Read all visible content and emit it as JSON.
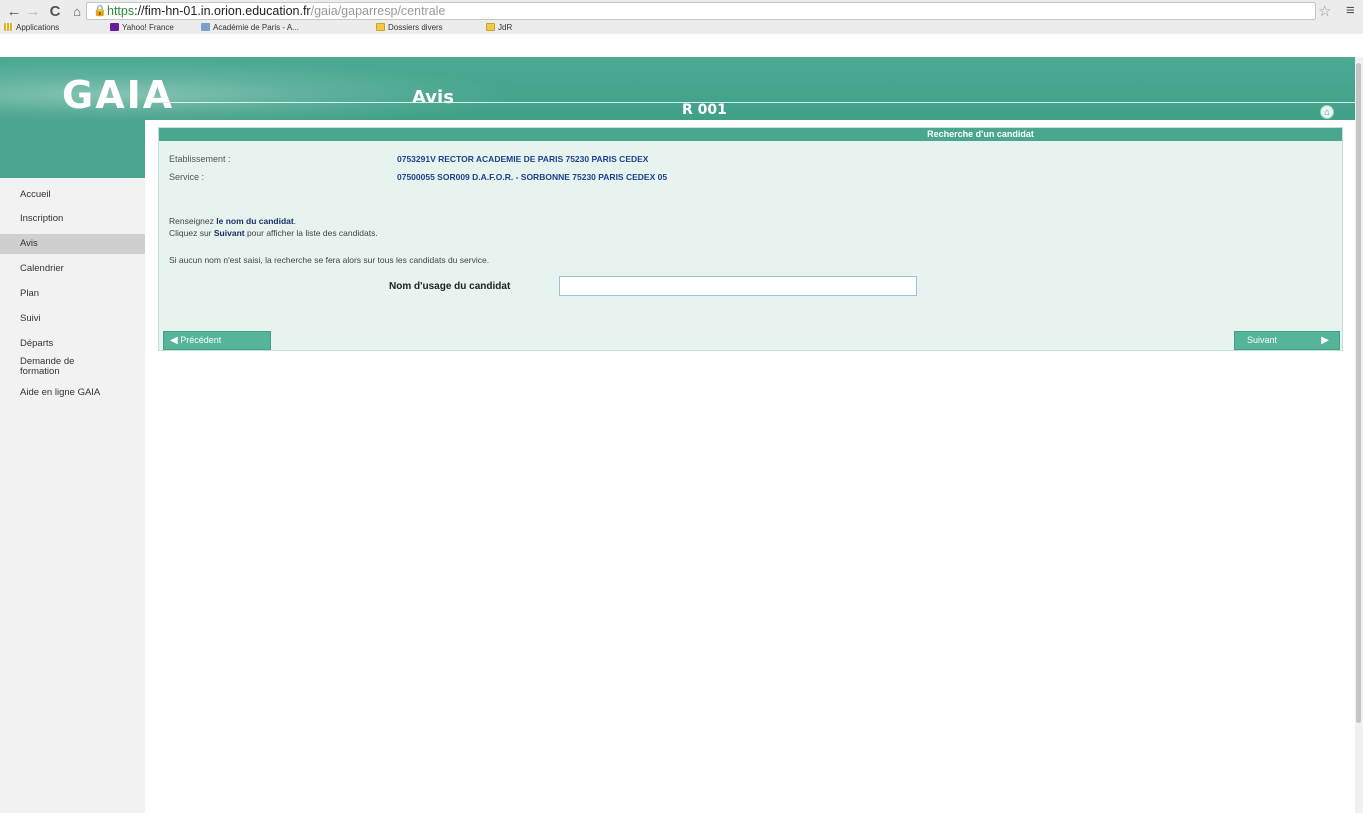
{
  "browser": {
    "url_scheme": "https",
    "url_host": "://fim-hn-01.in.orion.education.fr",
    "url_path": "/gaia/gaparresp/centrale",
    "bookmarks": [
      {
        "label": "Applications",
        "type": "apps"
      },
      {
        "label": "Yahoo! France",
        "type": "yahoo"
      },
      {
        "label": "Académie de Paris - A...",
        "type": "ac"
      },
      {
        "label": "Dossiers divers",
        "type": "folder"
      },
      {
        "label": "JdR",
        "type": "folder"
      }
    ]
  },
  "header": {
    "logo": "GAIA",
    "module": "Avis",
    "screen_code": "R 001"
  },
  "sidebar": {
    "items": [
      {
        "label": "Accueil"
      },
      {
        "label": "Inscription"
      },
      {
        "label": "Avis",
        "active": true
      },
      {
        "label": "Calendrier"
      },
      {
        "label": "Plan"
      },
      {
        "label": "Suivi"
      },
      {
        "label": "Départs"
      },
      {
        "label": "Demande de formation"
      },
      {
        "label": "Aide en ligne GAIA"
      }
    ]
  },
  "panel": {
    "title": "Recherche d'un candidat",
    "etablissement_label": "Etablissement :",
    "etablissement_value": "0753291V  RECTOR ACADEMIE DE PARIS 75230 PARIS CEDEX",
    "service_label": "Service :",
    "service_value": "07500055  SOR009 D.A.F.O.R. - SORBONNE 75230 PARIS CEDEX 05",
    "instr1_prefix": "Renseignez ",
    "instr1_bold": "le nom du candidat",
    "instr1_suffix": ".",
    "instr2_prefix": "Cliquez sur ",
    "instr2_bold": "Suivant",
    "instr2_suffix": " pour afficher la liste des candidats.",
    "instr3": "Si aucun nom n'est saisi, la recherche se fera alors sur tous les candidats  du service.",
    "name_label": "Nom d'usage du candidat",
    "name_value": "",
    "prev_label": "Précédent",
    "next_label": "Suivant"
  },
  "colors": {
    "header_green": "#4aa68f",
    "panel_bg": "#e6f3ee",
    "value_blue": "#1f3f8f"
  }
}
